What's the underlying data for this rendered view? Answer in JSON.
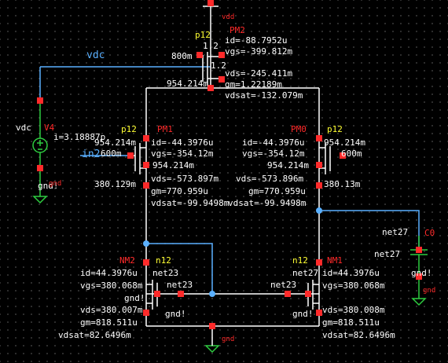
{
  "nets": {
    "vdc": "vdc",
    "in2": "in2",
    "vdc_src": "vdc",
    "net23_a": "net23",
    "net23_b": "net23",
    "net23_c": "net23",
    "net27_a": "net27",
    "net27_b": "net27",
    "net27_c": "net27",
    "gnd_main": "gnd",
    "gnd_v4": "gnd!",
    "gnd_c0": "gnd!",
    "gnd_c0b": "gnd",
    "gnd_v4b": "gnd",
    "gnd_nm2": "gnd!",
    "gnd_nm2b": "gnd!",
    "gnd_nm1b": "gnd!",
    "vdd": "vdd"
  },
  "V4": {
    "name": "V4",
    "current": "i=3.18887p",
    "node": "954.214m"
  },
  "C0": {
    "name": "C0"
  },
  "PM2": {
    "name": "PM2",
    "type": "p12",
    "id": "id=-88.7952u",
    "vgs": "vgs=-399.812m",
    "vds": "vds=-245.411m",
    "gm": "gm=1.22189m",
    "vdsat": "vdsat=-132.079m",
    "v_s": "1.2",
    "v_b": "1.2",
    "v_g": "800m",
    "v_d": "954.214m"
  },
  "PM1": {
    "name": "PM1",
    "type": "p12",
    "id": "id=-44.3976u",
    "vgs": "vgs=-354.12m",
    "vds": "vds=-573.897m",
    "gm": "gm=770.959u",
    "vdsat": "vdsat=-99.9498m",
    "v_s": "954.214m",
    "v_g": "600m",
    "v_b": "954.214m",
    "v_d": "380.129m"
  },
  "PM0": {
    "name": "PM0",
    "type": "p12",
    "id": "id=-44.3976u",
    "vgs": "vgs=-354.12m",
    "vds": "vds=-573.896m",
    "gm": "gm=770.959u",
    "vdsat": "vdsat=-99.9498m",
    "v_s": "954.214m",
    "v_g": "600m",
    "v_b": "954.214m",
    "v_d": "380.13m"
  },
  "NM2": {
    "name": "NM2",
    "type": "n12",
    "id": "id=44.3976u",
    "vgs": "vgs=380.068m",
    "vds": "vds=380.007m",
    "gm": "gm=818.511u",
    "vdsat": "vdsat=82.6496m"
  },
  "NM1": {
    "name": "NM1",
    "type": "n12",
    "id": "id=44.3976u",
    "vgs": "vgs=380.068m",
    "vds": "vds=380.008m",
    "gm": "gm=818.511u",
    "vdsat": "vdsat=82.6496m"
  },
  "colors": {
    "background": "#000000",
    "wire": "#ffffff",
    "label": "#ff2a2a",
    "device": "#ffff33",
    "pin_wire": "#5ab0ff",
    "component": "#2ecc40"
  }
}
